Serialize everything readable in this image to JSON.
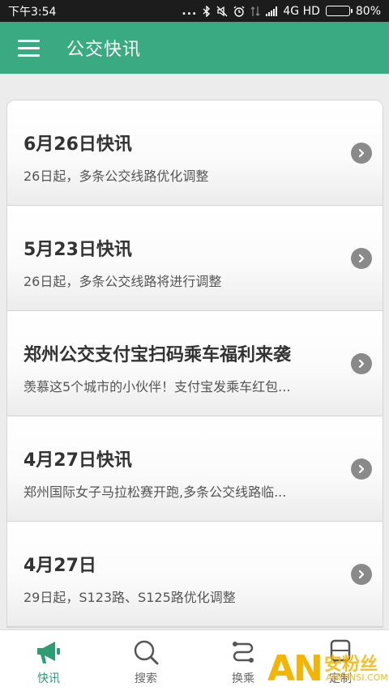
{
  "status_bar": {
    "time": "下午3:54",
    "dots": "...",
    "network": "4G HD",
    "battery_text": "80%",
    "battery_level": 0.8
  },
  "app_bar": {
    "title": "公交快讯"
  },
  "news": [
    {
      "title": "6月26日快讯",
      "subtitle": "26日起，多条公交线路优化调整"
    },
    {
      "title": "5月23日快讯",
      "subtitle": "26日起，多条公交线路将进行调整"
    },
    {
      "title": "郑州公交支付宝扫码乘车福利来袭",
      "subtitle": "羡慕这5个城市的小伙伴！支付宝发乘车红包..."
    },
    {
      "title": "4月27日快讯",
      "subtitle": "郑州国际女子马拉松赛开跑,多条公交线路临..."
    },
    {
      "title": "4月27日",
      "subtitle": "29日起，S123路、S125路优化调整"
    }
  ],
  "tabs": [
    {
      "label": "快讯",
      "icon": "megaphone-icon",
      "active": true
    },
    {
      "label": "搜索",
      "icon": "search-icon",
      "active": false
    },
    {
      "label": "换乘",
      "icon": "transfer-route-icon",
      "active": false
    },
    {
      "label": "定制",
      "icon": "bus-icon",
      "active": false
    }
  ],
  "watermark": {
    "logo": "AN",
    "name": "安粉丝",
    "url": "ANFENSI.COM"
  },
  "colors": {
    "primary": "#3aaa82",
    "tab_active": "#2f9d74",
    "status_bar": "#1c1c1c"
  }
}
